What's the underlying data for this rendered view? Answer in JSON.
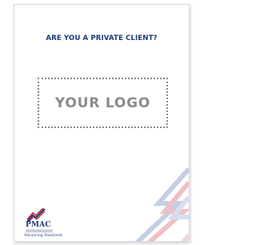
{
  "document": {
    "headline": "ARE YOU A PRIVATE CLIENT?",
    "logo_placeholder": "YOUR LOGO"
  },
  "brand": {
    "logo_label": "PMAC",
    "tagline": "Advancing Standards"
  },
  "colors": {
    "headline": "#1f3a7a",
    "placeholder_text": "#8a8a8a",
    "stripe_red": "#e8a0a6",
    "stripe_blue": "#b7c3dc"
  }
}
